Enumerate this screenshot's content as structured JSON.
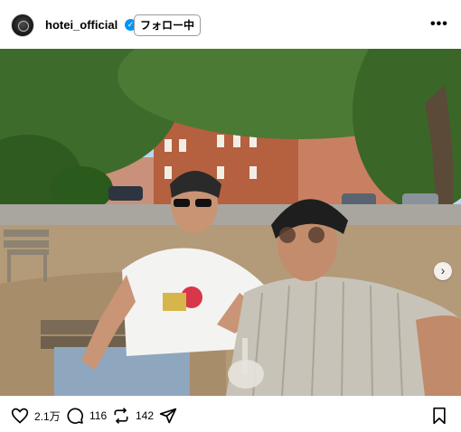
{
  "post": {
    "username": "hotei_official",
    "separator": "•",
    "follow_label": "フォロー中",
    "more_label": "•••",
    "verified_glyph": "✓"
  },
  "carousel": {
    "next_glyph": "›"
  },
  "actions": {
    "likes": "2.1万",
    "comments": "116",
    "reposts": "142"
  },
  "icons": {
    "avatar": "avatar",
    "verified": "verified-badge-icon",
    "like": "heart-icon",
    "comment": "comment-icon",
    "repost": "repost-icon",
    "share": "share-icon",
    "save": "bookmark-icon"
  },
  "colors": {
    "verified": "#0095f6",
    "text": "#000000"
  }
}
